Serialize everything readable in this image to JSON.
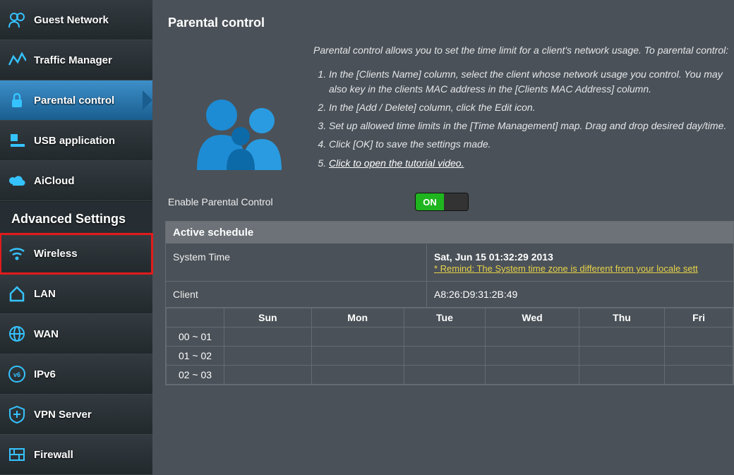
{
  "sidebar": {
    "general_items": [
      {
        "label": "Guest Network",
        "icon": "guest-icon",
        "active": false
      },
      {
        "label": "Traffic Manager",
        "icon": "traffic-icon",
        "active": false
      },
      {
        "label": "Parental control",
        "icon": "lock-icon",
        "active": true
      },
      {
        "label": "USB application",
        "icon": "usb-icon",
        "active": false
      },
      {
        "label": "AiCloud",
        "icon": "cloud-icon",
        "active": false
      }
    ],
    "advanced_title": "Advanced Settings",
    "advanced_items": [
      {
        "label": "Wireless",
        "icon": "wifi-icon",
        "highlighted": true
      },
      {
        "label": "LAN",
        "icon": "home-icon"
      },
      {
        "label": "WAN",
        "icon": "globe-icon"
      },
      {
        "label": "IPv6",
        "icon": "ipv6-icon"
      },
      {
        "label": "VPN Server",
        "icon": "vpn-icon"
      },
      {
        "label": "Firewall",
        "icon": "firewall-icon"
      }
    ]
  },
  "main": {
    "title": "Parental control",
    "intro_lead": "Parental control allows you to set the time limit for a client's network usage. To parental control:",
    "steps": [
      "In the [Clients Name] column, select the client whose network usage you control. You may also key in the clients MAC address in the [Clients MAC Address] column.",
      "In the [Add / Delete] column, click the Edit icon.",
      "Set up allowed time limits in the [Time Management] map. Drag and drop desired day/time.",
      "Click [OK] to save the settings made."
    ],
    "tutorial_link": "Click to open the tutorial video.",
    "enable_label": "Enable Parental Control",
    "enable_state": "ON",
    "schedule_title": "Active schedule",
    "system_time_label": "System Time",
    "system_time_value": "Sat, Jun 15  01:32:29  2013",
    "system_time_remind": "* Remind: The System time zone is different from your locale sett",
    "client_label": "Client",
    "client_value": "A8:26:D9:31:2B:49",
    "days": [
      "Sun",
      "Mon",
      "Tue",
      "Wed",
      "Thu",
      "Fri"
    ],
    "time_rows": [
      "00 ~ 01",
      "01 ~ 02",
      "02 ~ 03"
    ]
  }
}
